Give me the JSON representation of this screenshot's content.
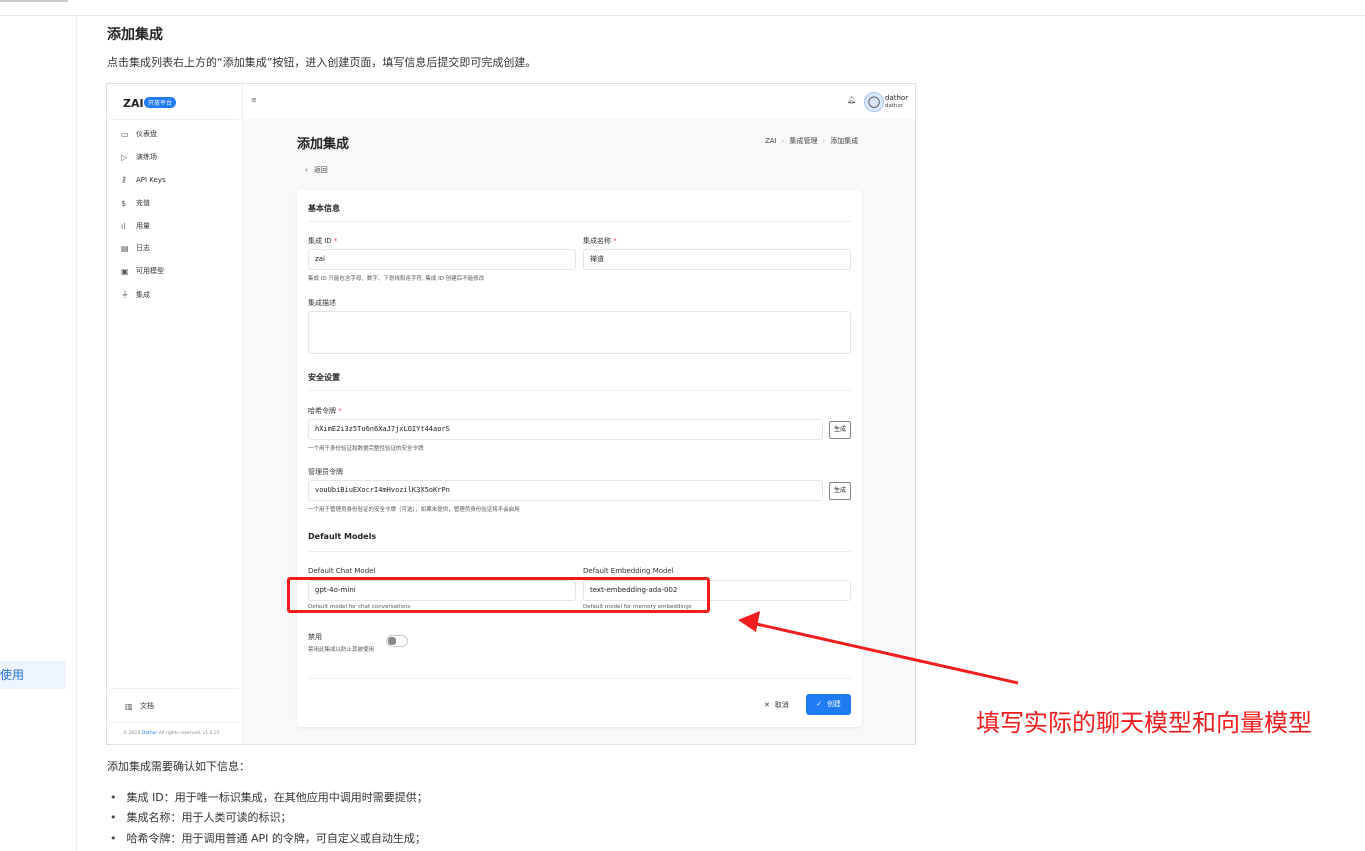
{
  "doc": {
    "heading": "添加集成",
    "intro": "点击集成列表右上方的“添加集成”按钮，进入创建页面，填写信息后提交即可完成创建。",
    "left_nav_active": "使用",
    "after_text": "添加集成需要确认如下信息：",
    "bullets": [
      "集成 ID：用于唯一标识集成，在其他应用中调用时需要提供；",
      "集成名称：用于人类可读的标识；",
      "哈希令牌：用于调用普通 API 的令牌，可自定义或自动生成；"
    ]
  },
  "app": {
    "logo": "ZAI",
    "badge": "开放平台",
    "menu_icon": "≡",
    "nav": [
      {
        "icon": "monitor-icon",
        "glyph": "▭",
        "label": "仪表盘"
      },
      {
        "icon": "play-icon",
        "glyph": "▷",
        "label": "演练场"
      },
      {
        "icon": "key-icon",
        "glyph": "⚷",
        "label": "API Keys"
      },
      {
        "icon": "dollar-icon",
        "glyph": "$",
        "label": "充值"
      },
      {
        "icon": "bar-chart-icon",
        "glyph": "ıl",
        "label": "用量"
      },
      {
        "icon": "file-icon",
        "glyph": "▤",
        "label": "日志"
      },
      {
        "icon": "cpu-icon",
        "glyph": "▣",
        "label": "可用模型"
      },
      {
        "icon": "plug-icon",
        "glyph": "⏚",
        "label": "集成"
      }
    ],
    "docs_label": "文档",
    "footer_prefix": "© 2025 ",
    "footer_brand": "Dathor",
    "footer_suffix": " All rights reserved. v1.0.21",
    "user_name": "dathor",
    "user_sub": "dathor",
    "page_title": "添加集成",
    "breadcrumb": [
      "ZAI",
      "集成管理",
      "添加集成"
    ],
    "back_label": "返回",
    "form": {
      "basic_title": "基本信息",
      "id_label": "集成 ID",
      "id_value": "zai",
      "id_hint": "集成 ID 只能包含字母、数字、下划线和连字符, 集成 ID 创建后不能修改",
      "name_label": "集成名称",
      "name_value": "禅道",
      "desc_label": "集成描述",
      "desc_value": "",
      "security_title": "安全设置",
      "hash_label": "哈希令牌",
      "hash_value": "hXimE2i3z5Tu6n6XaJ7jxLOIYt44aorS",
      "hash_hint": "一个用于身份验证和数据完整性验证的安全令牌",
      "admin_label": "管理员令牌",
      "admin_value": "vouUbiBiuEXocrI4mHvozilK3X5oKrPn",
      "admin_hint": "一个用于管理员身份验证的安全令牌（可选），如果未提供，管理员身份验证将不会启用",
      "generate_label": "生成",
      "models_title": "Default Models",
      "chat_label": "Default Chat Model",
      "chat_value": "gpt-4o-mini",
      "chat_hint": "Default model for chat conversations",
      "embed_label": "Default Embedding Model",
      "embed_value": "text-embedding-ada-002",
      "embed_hint": "Default model for memory embeddings",
      "disable_label": "禁用",
      "disable_hint": "禁用此集成以防止其被使用",
      "disabled": false,
      "cancel_label": "取消",
      "create_label": "创建"
    }
  },
  "annotation": {
    "text": "填写实际的聊天模型和向量模型",
    "color": "#f21c1c"
  },
  "accent": "#1e7bf2"
}
